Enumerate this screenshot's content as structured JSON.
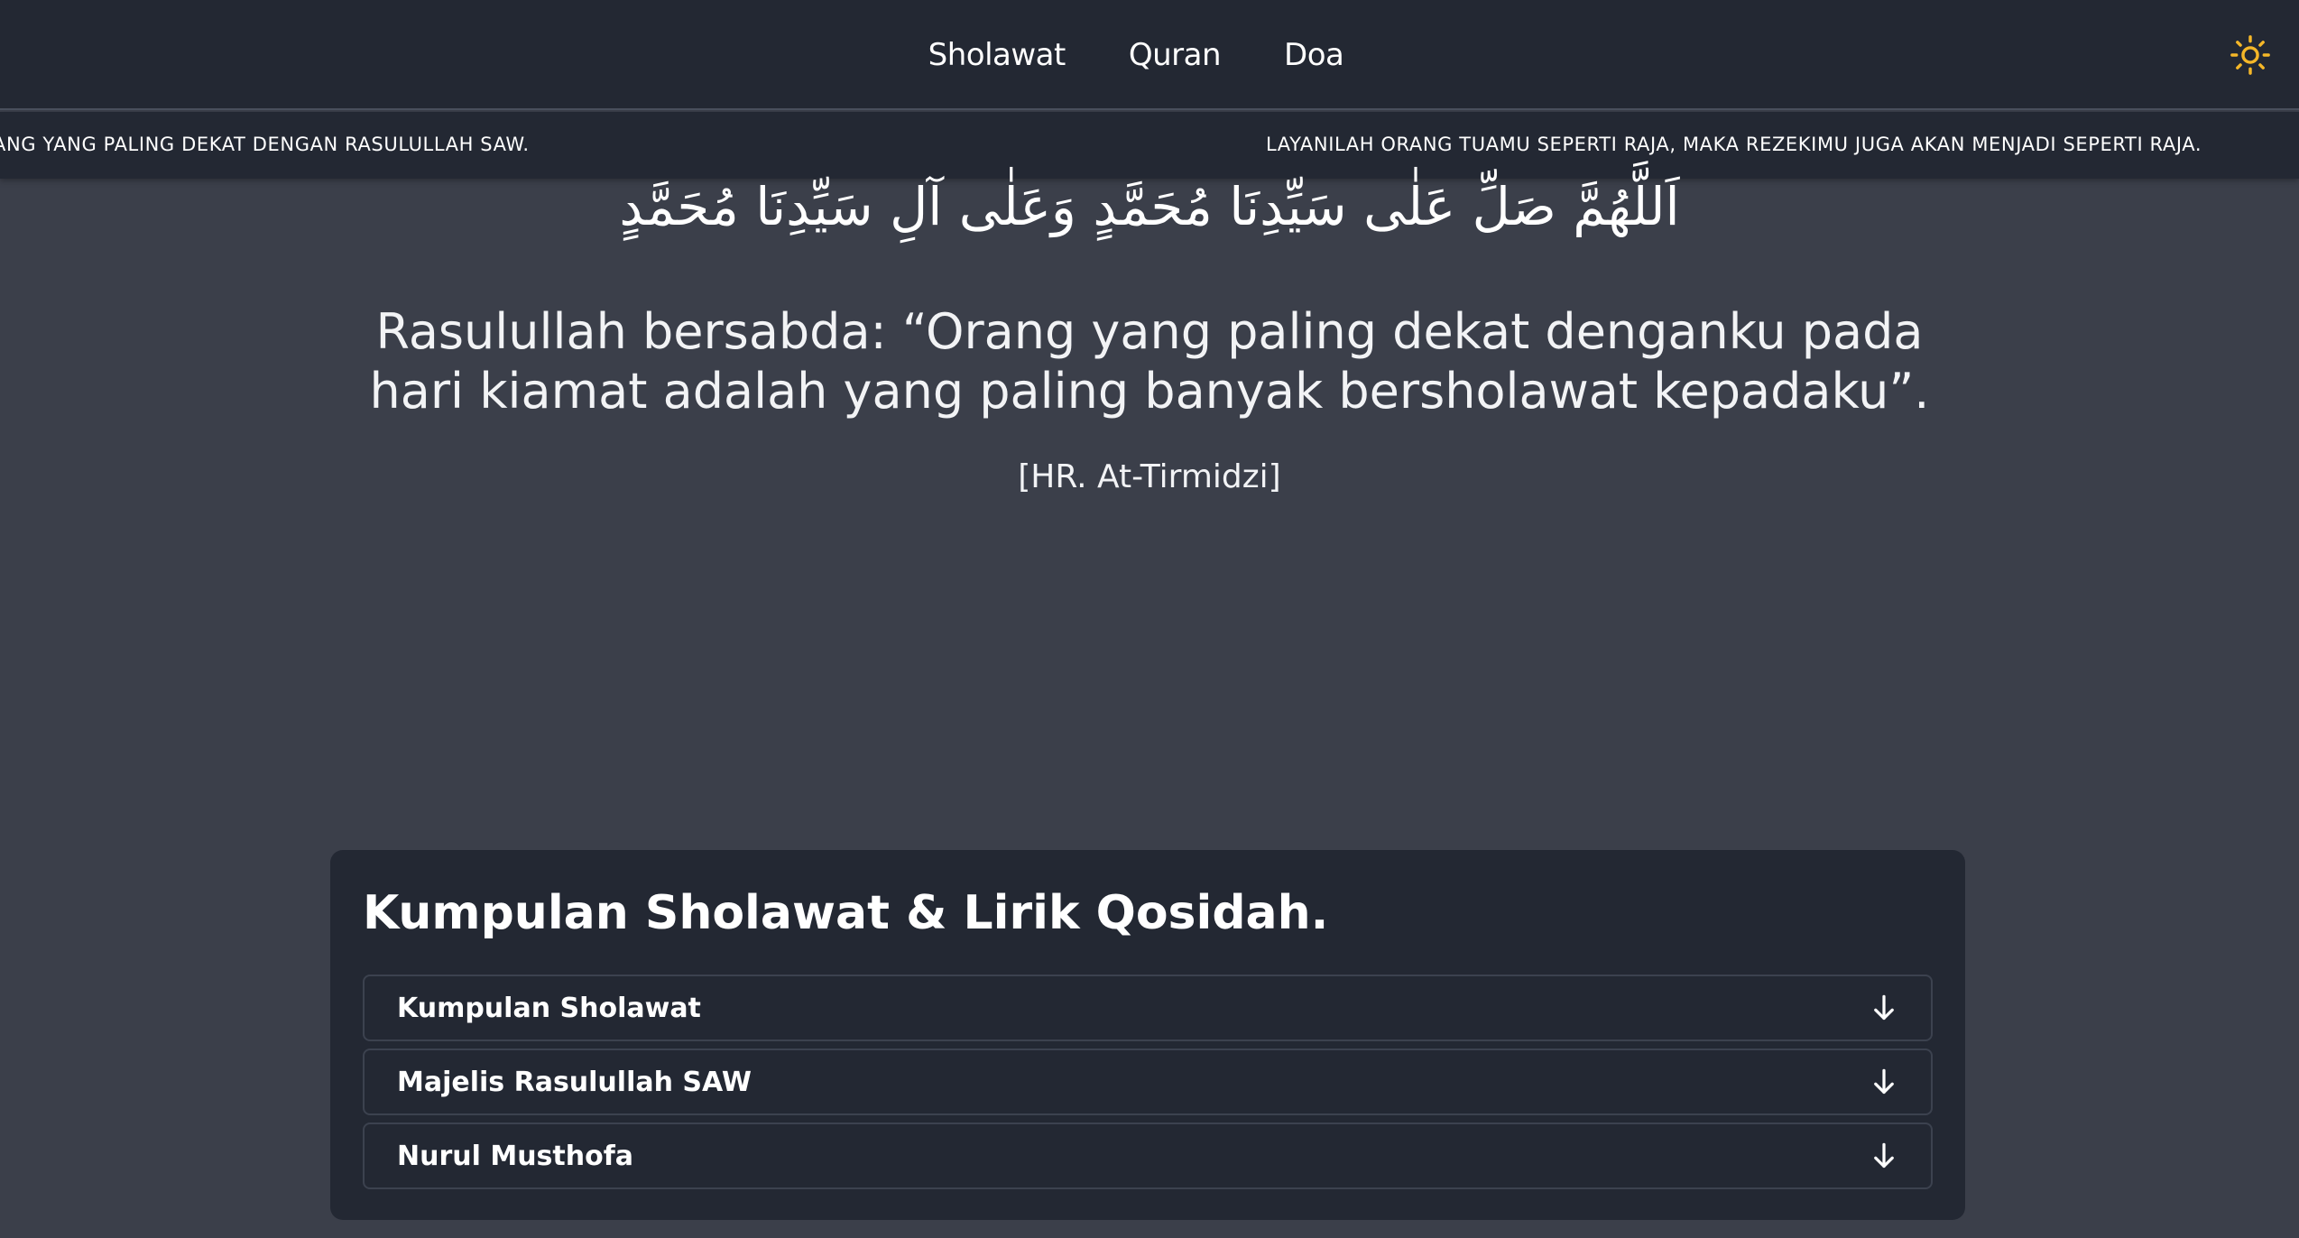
{
  "nav": {
    "items": [
      {
        "label": "Sholawat"
      },
      {
        "label": "Quran"
      },
      {
        "label": "Doa"
      }
    ],
    "theme_icon": "sun-icon",
    "theme_icon_color": "#f5b728"
  },
  "ticker": {
    "items": [
      "ANG YANG PALING DEKAT DENGAN RASULULLAH SAW.",
      "LAYANILAH ORANG TUAMU SEPERTI RAJA, MAKA REZEKIMU JUGA AKAN MENJADI SEPERTI RAJA."
    ]
  },
  "hero": {
    "arabic": "اَللَّهُمَّ صَلِّ عَلٰى سَيِّدِنَا مُحَمَّدٍ وَعَلٰى آلِ سَيِّدِنَا مُحَمَّدٍ",
    "quote": "Rasulullah bersabda: “Orang yang paling dekat denganku pada hari kiamat adalah yang paling banyak bersholawat kepadaku”.",
    "source": "[HR. At-Tirmidzi]"
  },
  "collection": {
    "title": "Kumpulan Sholawat & Lirik Qosidah.",
    "accordions": [
      {
        "label": "Kumpulan Sholawat",
        "icon": "arrow-down-icon"
      },
      {
        "label": "Majelis Rasulullah SAW",
        "icon": "arrow-down-icon"
      },
      {
        "label": "Nurul Musthofa",
        "icon": "arrow-down-icon"
      }
    ]
  },
  "colors": {
    "background": "#3b3f4a",
    "surface": "#232833",
    "border": "#3c424f",
    "accent": "#f5b728"
  }
}
